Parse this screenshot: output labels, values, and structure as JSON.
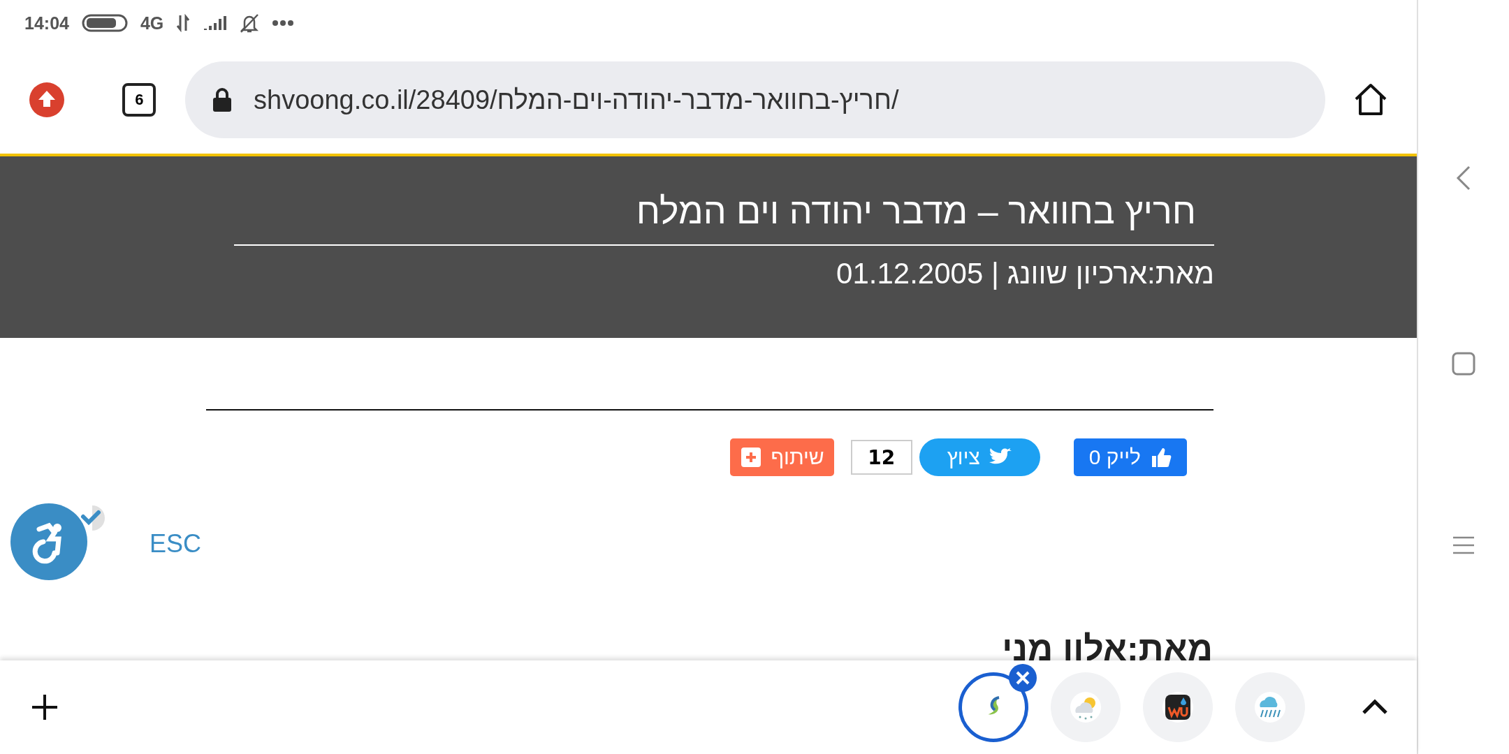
{
  "status_bar": {
    "time": "14:04",
    "network": "4G"
  },
  "browser": {
    "tab_count": "6",
    "url": "shvoong.co.il/28409/חריץ-בחוואר-מדבר-יהודה-וים-המלח/"
  },
  "article": {
    "title": "חריץ בחוואר – מדבר יהודה וים המלח",
    "byline": "מאת:ארכיון שוונג | 01.12.2005"
  },
  "share_bar": {
    "like": "לייק 0",
    "tweet": "ציוץ",
    "tweet_count": "12",
    "share": "שיתוף"
  },
  "accessibility": {
    "checked": true,
    "esc": "ESC"
  },
  "next_byline": "מאת:אלון מני",
  "bottom_bar": {
    "apps": [
      {
        "kind": "leaf",
        "selected": true
      },
      {
        "kind": "cloud-sun",
        "selected": false
      },
      {
        "kind": "wu",
        "selected": false
      },
      {
        "kind": "rain",
        "selected": false
      }
    ]
  }
}
